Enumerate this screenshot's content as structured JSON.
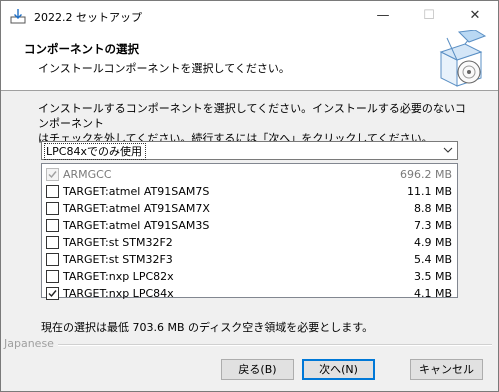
{
  "window": {
    "title": "2022.2 セットアップ",
    "minimize_glyph": "—",
    "maximize_glyph": "☐",
    "close_glyph": "✕"
  },
  "header": {
    "title": "コンポーネントの選択",
    "subtitle": "インストールコンポーネントを選択してください。"
  },
  "description": {
    "line1": "インストールするコンポーネントを選択してください。インストールする必要のないコンポーネント",
    "line2": "はチェックを外してください。続行するには「次へ」をクリックしてください。"
  },
  "install_type": {
    "selected": "LPC84xでのみ使用"
  },
  "components": [
    {
      "name": "ARMGCC",
      "size": "696.2 MB",
      "checked": true,
      "disabled": true
    },
    {
      "name": "TARGET:atmel AT91SAM7S",
      "size": "11.1 MB",
      "checked": false,
      "disabled": false
    },
    {
      "name": "TARGET:atmel AT91SAM7X",
      "size": "8.8 MB",
      "checked": false,
      "disabled": false
    },
    {
      "name": "TARGET:atmel AT91SAM3S",
      "size": "7.3 MB",
      "checked": false,
      "disabled": false
    },
    {
      "name": "TARGET:st STM32F2",
      "size": "4.9 MB",
      "checked": false,
      "disabled": false
    },
    {
      "name": "TARGET:st STM32F3",
      "size": "5.4 MB",
      "checked": false,
      "disabled": false
    },
    {
      "name": "TARGET:nxp LPC82x",
      "size": "3.5 MB",
      "checked": false,
      "disabled": false
    },
    {
      "name": "TARGET:nxp LPC84x",
      "size": "4.1 MB",
      "checked": true,
      "disabled": false
    }
  ],
  "space_required": "現在の選択は最低 703.6 MB のディスク空き領域を必要とします。",
  "separator_label": "Japanese",
  "buttons": {
    "back": "戻る(B)",
    "next": "次へ(N)",
    "cancel": "キャンセル"
  },
  "colors": {
    "accent": "#0078d7",
    "check": "#222222",
    "check_disabled": "#a0a0a0"
  }
}
